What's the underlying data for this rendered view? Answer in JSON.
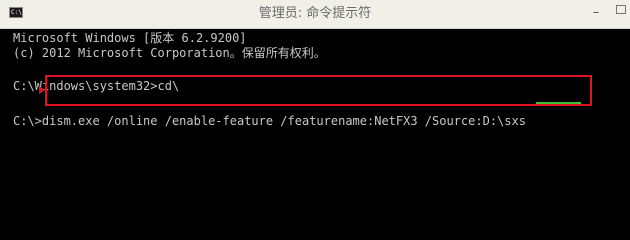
{
  "window": {
    "title": "管理员: 命令提示符",
    "icon_label": "C:\\",
    "minimize_glyph": "–"
  },
  "console": {
    "lines": [
      "Microsoft Windows [版本 6.2.9200]",
      "(c) 2012 Microsoft Corporation。保留所有权利。",
      "C:\\Windows\\system32>cd\\",
      "C:\\>dism.exe /online /enable-feature /featurename:NetFX3 /Source:D:\\sxs"
    ]
  },
  "annotations": {
    "highlight_color": "#e0141e",
    "underline_color": "#39c231"
  },
  "colors": {
    "console_bg": "#000000",
    "console_text": "#c8c8c8",
    "titlebar_bg": "#f0efe8"
  }
}
